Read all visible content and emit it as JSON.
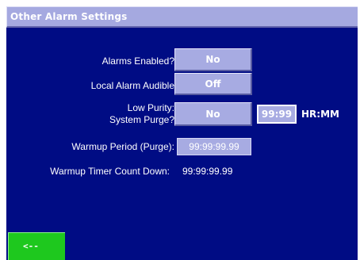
{
  "window": {
    "title": "Other Alarm Settings"
  },
  "settings": {
    "alarms_enabled": {
      "label": "Alarms Enabled?",
      "value": "No"
    },
    "local_alarm_audible": {
      "label": "Local Alarm Audible",
      "value": "Off"
    },
    "low_purity": {
      "label_line1": "Low Purity:",
      "label_line2": "System Purge?",
      "value": "No",
      "time": "99:99",
      "unit": "HR:MM"
    },
    "warmup_period": {
      "label": "Warmup Period (Purge):",
      "value": "99:99:99.99"
    },
    "warmup_timer": {
      "label": "Warmup Timer Count Down:",
      "value": "99:99:99.99"
    }
  },
  "navigation": {
    "back_label": "<--",
    "back_icon": "back-arrow-icon"
  },
  "colors": {
    "background": "#000c84",
    "title_bar": "#a5a9e0",
    "button": "#a7abe2",
    "back_button": "#1ec81e",
    "text": "#ffffff"
  }
}
